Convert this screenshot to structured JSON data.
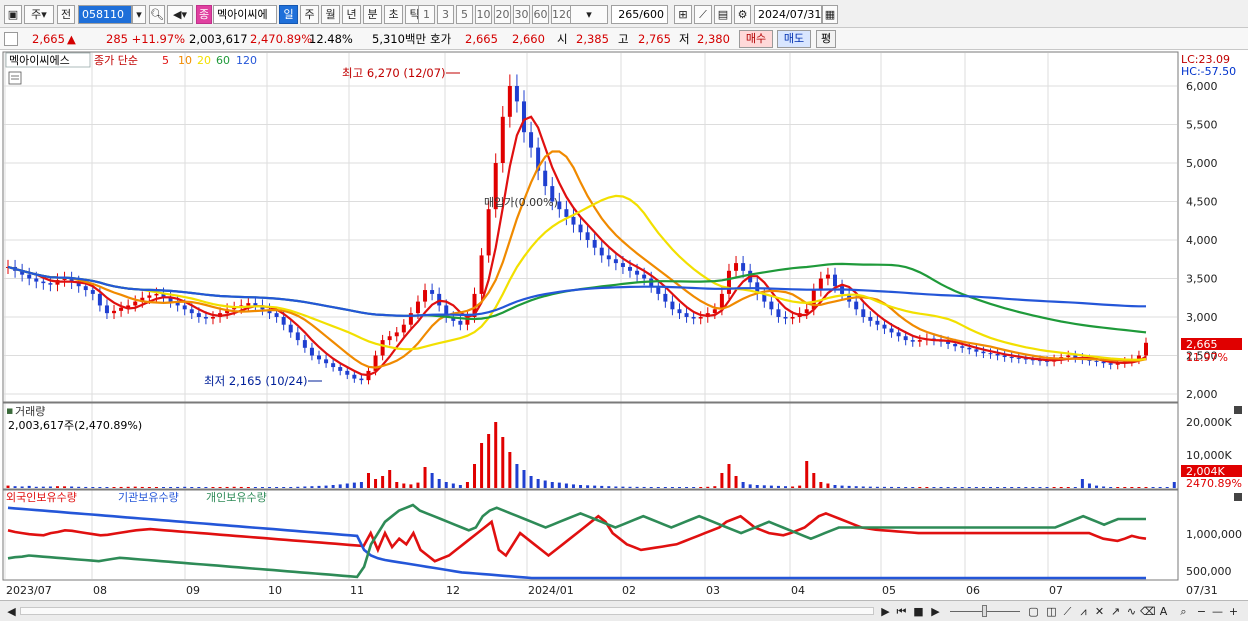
{
  "toolbar": {
    "period_selector": "주",
    "prev_button": "전",
    "stock_code": "058110",
    "stock_badge": "종",
    "stock_name": "멕아이씨에",
    "period_tabs": [
      "일",
      "주",
      "월",
      "년",
      "분",
      "초",
      "틱"
    ],
    "active_period": "일",
    "minute_options": [
      "1",
      "3",
      "5",
      "10",
      "20",
      "30",
      "60",
      "120"
    ],
    "count_value": "265",
    "count_total": "/600",
    "date_value": "2024/07/31"
  },
  "infobar": {
    "price": "2,665",
    "change": "285 +11.97%",
    "volume": "2,003,617",
    "volume_ratio": "2,470.89%",
    "turnover_rate": "12.48%",
    "trade_value": "5,310백만",
    "quote_label": "호가",
    "ask_price": "2,665",
    "bid_price": "2,660",
    "open_label": "시",
    "open_value": "2,385",
    "high_label": "고",
    "high_value": "2,765",
    "low_label": "저",
    "low_value": "2,380",
    "buy_button": "매수",
    "sell_button": "매도",
    "eval_button": "평"
  },
  "price_panel": {
    "stock_label": "멕아이씨에스",
    "ma_label": "종가 단순",
    "ma_periods": [
      "5",
      "10",
      "20",
      "60",
      "120"
    ],
    "ma_colors": [
      "#e01010",
      "#f08a00",
      "#f2e000",
      "#1f9a3a",
      "#2456d8"
    ],
    "high_annotation": "최고 6,270 (12/07)",
    "low_annotation": "최저 2,165 (10/24)",
    "mid_annotation": "매입가(0.00%)",
    "lc_label": "LC:23.09",
    "hc_label": "HC:-57.50",
    "current_price_tag": "2,665",
    "current_change_tag": "11.97%",
    "y_ticks": [
      "6,000",
      "5,500",
      "5,000",
      "4,500",
      "4,000",
      "3,500",
      "3,000",
      "2,500",
      "2,000"
    ]
  },
  "volume_panel": {
    "title": "거래량",
    "value_label": "2,003,617주(2,470.89%)",
    "y_ticks": [
      "20,000K",
      "10,000K"
    ],
    "current_tag": "2,004K",
    "current_pct": "2470.89%"
  },
  "holder_panel": {
    "series_labels": [
      "외국인보유수량",
      "기관보유수량",
      "개인보유수량"
    ],
    "series_colors": [
      "#e01010",
      "#2456d8",
      "#2e8b57"
    ],
    "y_ticks": [
      "1,000,000",
      "500,000"
    ]
  },
  "x_axis": {
    "labels": [
      "2023/07",
      "08",
      "09",
      "10",
      "11",
      "12",
      "2024/01",
      "02",
      "03",
      "04",
      "05",
      "06",
      "07"
    ],
    "end_label": "07/31"
  },
  "chart_data": {
    "type": "candlestick",
    "x_start": "2023/07",
    "x_end": "2024/07/31",
    "price_range": [
      2000,
      6270
    ],
    "highest": {
      "value": 6270,
      "date": "12/07"
    },
    "lowest": {
      "value": 2165,
      "date": "10/24"
    },
    "ma_periods": [
      5,
      10,
      20,
      60,
      120
    ],
    "closes": [
      3650,
      3600,
      3550,
      3500,
      3460,
      3440,
      3420,
      3480,
      3500,
      3450,
      3400,
      3350,
      3300,
      3150,
      3050,
      3080,
      3120,
      3150,
      3200,
      3250,
      3280,
      3300,
      3250,
      3200,
      3150,
      3100,
      3050,
      3000,
      2980,
      3000,
      3050,
      3100,
      3120,
      3150,
      3180,
      3150,
      3100,
      3050,
      3000,
      2900,
      2800,
      2700,
      2600,
      2500,
      2450,
      2400,
      2350,
      2300,
      2250,
      2200,
      2180,
      2300,
      2500,
      2700,
      2750,
      2800,
      2900,
      3050,
      3200,
      3350,
      3300,
      3150,
      3000,
      2950,
      2900,
      3000,
      3300,
      3800,
      4400,
      5000,
      5600,
      6000,
      5800,
      5400,
      5200,
      4900,
      4700,
      4500,
      4400,
      4300,
      4200,
      4100,
      4000,
      3900,
      3800,
      3750,
      3700,
      3650,
      3600,
      3550,
      3500,
      3400,
      3300,
      3200,
      3100,
      3050,
      3000,
      2980,
      3000,
      3050,
      3100,
      3300,
      3600,
      3700,
      3600,
      3450,
      3300,
      3200,
      3100,
      3000,
      2980,
      3000,
      3050,
      3100,
      3350,
      3500,
      3550,
      3400,
      3300,
      3200,
      3100,
      3000,
      2950,
      2900,
      2850,
      2800,
      2750,
      2700,
      2680,
      2700,
      2720,
      2700,
      2680,
      2650,
      2620,
      2600,
      2580,
      2550,
      2530,
      2520,
      2500,
      2480,
      2470,
      2460,
      2450,
      2440,
      2430,
      2420,
      2450,
      2480,
      2500,
      2470,
      2450,
      2430,
      2420,
      2400,
      2380,
      2400,
      2420,
      2450,
      2500,
      2665
    ],
    "volume_k": [
      800,
      600,
      500,
      700,
      400,
      450,
      500,
      600,
      550,
      500,
      400,
      350,
      300,
      300,
      250,
      300,
      350,
      400,
      450,
      350,
      300,
      280,
      260,
      300,
      350,
      400,
      300,
      250,
      200,
      250,
      300,
      350,
      400,
      350,
      300,
      280,
      260,
      240,
      220,
      200,
      300,
      400,
      500,
      600,
      700,
      800,
      1000,
      1200,
      1500,
      1800,
      2000,
      5000,
      3000,
      4000,
      6000,
      2000,
      1500,
      1200,
      1800,
      7000,
      5000,
      3000,
      2000,
      1500,
      1000,
      2000,
      8000,
      15000,
      18000,
      22000,
      17000,
      12000,
      8000,
      6000,
      4000,
      3000,
      2500,
      2000,
      1800,
      1500,
      1200,
      1000,
      900,
      800,
      700,
      600,
      500,
      450,
      400,
      380,
      350,
      300,
      280,
      260,
      240,
      220,
      200,
      250,
      300,
      400,
      600,
      5000,
      8000,
      4000,
      2000,
      1200,
      1000,
      900,
      800,
      700,
      600,
      500,
      800,
      9000,
      5000,
      2000,
      1500,
      1000,
      800,
      700,
      600,
      500,
      450,
      400,
      380,
      360,
      340,
      320,
      300,
      280,
      260,
      240,
      220,
      200,
      190,
      180,
      170,
      160,
      150,
      140,
      130,
      120,
      110,
      100,
      90,
      80,
      70,
      60,
      50,
      60,
      70,
      80,
      3000,
      1500,
      800,
      500,
      300,
      200,
      150,
      120,
      100,
      90,
      80,
      70,
      60,
      2004
    ],
    "foreign_holding": [
      950000,
      920000,
      900000,
      880000,
      870000,
      860000,
      900000,
      920000,
      950000,
      940000,
      920000,
      900000,
      880000,
      860000,
      870000,
      890000,
      910000,
      930000,
      950000,
      960000,
      970000,
      960000,
      950000,
      940000,
      930000,
      920000,
      910000,
      900000,
      890000,
      880000,
      870000,
      860000,
      850000,
      840000,
      830000,
      820000,
      810000,
      800000,
      790000,
      780000,
      770000,
      760000,
      750000,
      740000,
      730000,
      720000,
      710000,
      700000,
      690000,
      680000,
      670000,
      900000,
      600000,
      900000,
      650000,
      800000,
      700000,
      900000,
      600000,
      500000,
      400000,
      450000,
      500000,
      600000,
      700000,
      800000,
      900000,
      1000000,
      1100000,
      600000,
      500000,
      700000,
      900000,
      800000,
      700000,
      600000,
      500000,
      600000,
      700000,
      800000,
      900000,
      1000000,
      1100000,
      1200000,
      1100000,
      900000,
      800000,
      700000,
      650000,
      600000,
      620000,
      640000,
      660000,
      680000,
      700000,
      750000,
      800000,
      850000,
      900000,
      950000,
      1000000,
      1100000,
      1150000,
      1200000,
      1100000,
      1000000,
      950000,
      900000,
      880000,
      860000,
      900000,
      950000,
      1000000,
      1100000,
      1200000,
      1250000,
      1200000,
      1150000,
      1100000,
      1050000,
      1000000,
      980000,
      960000,
      950000,
      940000,
      930000,
      920000,
      910000,
      900000,
      900000,
      900000,
      900000,
      900000,
      900000,
      900000,
      900000,
      900000,
      900000,
      900000,
      900000,
      900000,
      900000,
      900000,
      900000,
      900000,
      900000,
      900000,
      900000,
      900000,
      900000,
      900000,
      900000,
      900000,
      850000,
      800000,
      780000,
      760000,
      800000,
      850000,
      820000,
      800000
    ],
    "institution_holding": [
      1350000,
      1340000,
      1330000,
      1320000,
      1310000,
      1300000,
      1290000,
      1280000,
      1270000,
      1260000,
      1250000,
      1240000,
      1230000,
      1220000,
      1210000,
      1200000,
      1190000,
      1180000,
      1170000,
      1160000,
      1150000,
      1140000,
      1130000,
      1120000,
      1110000,
      1100000,
      1090000,
      1080000,
      1070000,
      1060000,
      1050000,
      1040000,
      1030000,
      1020000,
      1010000,
      1000000,
      990000,
      980000,
      970000,
      960000,
      950000,
      940000,
      930000,
      920000,
      910000,
      900000,
      890000,
      880000,
      870000,
      860000,
      850000,
      600000,
      500000,
      450000,
      420000,
      400000,
      380000,
      360000,
      340000,
      320000,
      300000,
      280000,
      260000,
      240000,
      220000,
      200000,
      190000,
      180000,
      170000,
      160000,
      150000,
      140000,
      130000,
      120000,
      110000,
      100000,
      100000,
      100000,
      100000,
      100000,
      100000,
      100000,
      100000,
      100000,
      100000,
      100000,
      100000,
      100000,
      100000,
      100000,
      100000,
      100000,
      100000,
      100000,
      100000,
      100000,
      100000,
      100000,
      100000,
      100000,
      100000,
      100000,
      100000,
      100000,
      100000,
      100000,
      100000,
      100000,
      100000,
      100000,
      100000,
      100000,
      100000,
      100000,
      100000,
      100000,
      100000,
      100000,
      100000,
      100000,
      100000,
      100000,
      100000,
      100000,
      100000,
      100000,
      100000,
      100000,
      100000,
      100000,
      100000,
      100000,
      100000,
      100000,
      100000,
      100000,
      100000,
      100000,
      100000,
      100000,
      100000,
      100000,
      100000,
      100000,
      100000,
      100000,
      100000,
      100000,
      100000,
      100000,
      100000,
      100000,
      100000,
      100000,
      100000,
      100000,
      100000,
      100000,
      100000,
      100000,
      100000,
      100000,
      100000,
      100000
    ],
    "individual_holding": [
      450000,
      470000,
      480000,
      500000,
      490000,
      480000,
      470000,
      460000,
      450000,
      440000,
      430000,
      420000,
      410000,
      400000,
      420000,
      440000,
      460000,
      450000,
      440000,
      430000,
      420000,
      410000,
      400000,
      390000,
      380000,
      370000,
      360000,
      350000,
      340000,
      330000,
      320000,
      310000,
      300000,
      290000,
      280000,
      270000,
      260000,
      250000,
      240000,
      230000,
      220000,
      210000,
      200000,
      190000,
      180000,
      170000,
      160000,
      150000,
      140000,
      130000,
      120000,
      300000,
      700000,
      900000,
      1100000,
      1200000,
      1300000,
      1350000,
      1400000,
      1300000,
      1250000,
      1200000,
      1150000,
      1100000,
      1050000,
      1000000,
      950000,
      1000000,
      1200000,
      1300000,
      1350000,
      1300000,
      1250000,
      1200000,
      1150000,
      1100000,
      1050000,
      1000000,
      1050000,
      1100000,
      1150000,
      1200000,
      1250000,
      1200000,
      1150000,
      1100000,
      1050000,
      1000000,
      1050000,
      1100000,
      1150000,
      1200000,
      1150000,
      1100000,
      1050000,
      1000000,
      1050000,
      1100000,
      1150000,
      1200000,
      1150000,
      1100000,
      1050000,
      1000000,
      950000,
      900000,
      950000,
      1000000,
      1050000,
      1100000,
      1050000,
      1000000,
      950000,
      900000,
      850000,
      800000,
      850000,
      900000,
      950000,
      1000000,
      1000000,
      1000000,
      1000000,
      1000000,
      1000000,
      1000000,
      1000000,
      1000000,
      1000000,
      1000000,
      1000000,
      1000000,
      1000000,
      1000000,
      1000000,
      1000000,
      1000000,
      1000000,
      1000000,
      1000000,
      1000000,
      1000000,
      1000000,
      1000000,
      1000000,
      1000000,
      1000000,
      1000000,
      1000000,
      1000000,
      1000000,
      1050000,
      1100000,
      1150000,
      1200000,
      1150000,
      1100000,
      1050000,
      1100000,
      1150000,
      1150000,
      1150000,
      1150000,
      1150000
    ]
  }
}
